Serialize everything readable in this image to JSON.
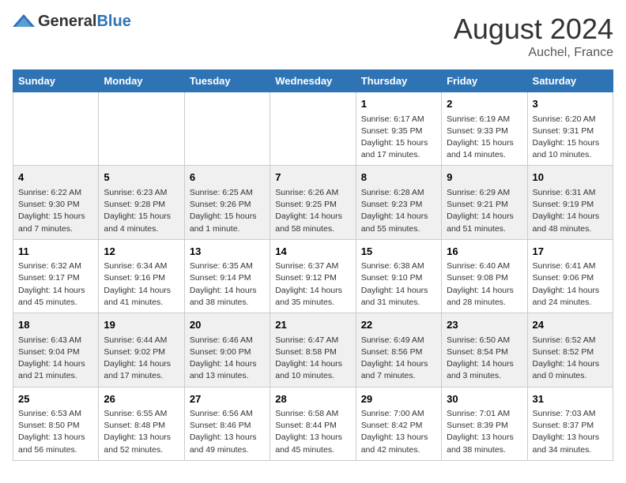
{
  "header": {
    "logo_general": "General",
    "logo_blue": "Blue",
    "month_year": "August 2024",
    "location": "Auchel, France"
  },
  "days_of_week": [
    "Sunday",
    "Monday",
    "Tuesday",
    "Wednesday",
    "Thursday",
    "Friday",
    "Saturday"
  ],
  "weeks": [
    [
      {
        "day": "",
        "info": ""
      },
      {
        "day": "",
        "info": ""
      },
      {
        "day": "",
        "info": ""
      },
      {
        "day": "",
        "info": ""
      },
      {
        "day": "1",
        "info": "Sunrise: 6:17 AM\nSunset: 9:35 PM\nDaylight: 15 hours and 17 minutes."
      },
      {
        "day": "2",
        "info": "Sunrise: 6:19 AM\nSunset: 9:33 PM\nDaylight: 15 hours and 14 minutes."
      },
      {
        "day": "3",
        "info": "Sunrise: 6:20 AM\nSunset: 9:31 PM\nDaylight: 15 hours and 10 minutes."
      }
    ],
    [
      {
        "day": "4",
        "info": "Sunrise: 6:22 AM\nSunset: 9:30 PM\nDaylight: 15 hours and 7 minutes."
      },
      {
        "day": "5",
        "info": "Sunrise: 6:23 AM\nSunset: 9:28 PM\nDaylight: 15 hours and 4 minutes."
      },
      {
        "day": "6",
        "info": "Sunrise: 6:25 AM\nSunset: 9:26 PM\nDaylight: 15 hours and 1 minute."
      },
      {
        "day": "7",
        "info": "Sunrise: 6:26 AM\nSunset: 9:25 PM\nDaylight: 14 hours and 58 minutes."
      },
      {
        "day": "8",
        "info": "Sunrise: 6:28 AM\nSunset: 9:23 PM\nDaylight: 14 hours and 55 minutes."
      },
      {
        "day": "9",
        "info": "Sunrise: 6:29 AM\nSunset: 9:21 PM\nDaylight: 14 hours and 51 minutes."
      },
      {
        "day": "10",
        "info": "Sunrise: 6:31 AM\nSunset: 9:19 PM\nDaylight: 14 hours and 48 minutes."
      }
    ],
    [
      {
        "day": "11",
        "info": "Sunrise: 6:32 AM\nSunset: 9:17 PM\nDaylight: 14 hours and 45 minutes."
      },
      {
        "day": "12",
        "info": "Sunrise: 6:34 AM\nSunset: 9:16 PM\nDaylight: 14 hours and 41 minutes."
      },
      {
        "day": "13",
        "info": "Sunrise: 6:35 AM\nSunset: 9:14 PM\nDaylight: 14 hours and 38 minutes."
      },
      {
        "day": "14",
        "info": "Sunrise: 6:37 AM\nSunset: 9:12 PM\nDaylight: 14 hours and 35 minutes."
      },
      {
        "day": "15",
        "info": "Sunrise: 6:38 AM\nSunset: 9:10 PM\nDaylight: 14 hours and 31 minutes."
      },
      {
        "day": "16",
        "info": "Sunrise: 6:40 AM\nSunset: 9:08 PM\nDaylight: 14 hours and 28 minutes."
      },
      {
        "day": "17",
        "info": "Sunrise: 6:41 AM\nSunset: 9:06 PM\nDaylight: 14 hours and 24 minutes."
      }
    ],
    [
      {
        "day": "18",
        "info": "Sunrise: 6:43 AM\nSunset: 9:04 PM\nDaylight: 14 hours and 21 minutes."
      },
      {
        "day": "19",
        "info": "Sunrise: 6:44 AM\nSunset: 9:02 PM\nDaylight: 14 hours and 17 minutes."
      },
      {
        "day": "20",
        "info": "Sunrise: 6:46 AM\nSunset: 9:00 PM\nDaylight: 14 hours and 13 minutes."
      },
      {
        "day": "21",
        "info": "Sunrise: 6:47 AM\nSunset: 8:58 PM\nDaylight: 14 hours and 10 minutes."
      },
      {
        "day": "22",
        "info": "Sunrise: 6:49 AM\nSunset: 8:56 PM\nDaylight: 14 hours and 7 minutes."
      },
      {
        "day": "23",
        "info": "Sunrise: 6:50 AM\nSunset: 8:54 PM\nDaylight: 14 hours and 3 minutes."
      },
      {
        "day": "24",
        "info": "Sunrise: 6:52 AM\nSunset: 8:52 PM\nDaylight: 14 hours and 0 minutes."
      }
    ],
    [
      {
        "day": "25",
        "info": "Sunrise: 6:53 AM\nSunset: 8:50 PM\nDaylight: 13 hours and 56 minutes."
      },
      {
        "day": "26",
        "info": "Sunrise: 6:55 AM\nSunset: 8:48 PM\nDaylight: 13 hours and 52 minutes."
      },
      {
        "day": "27",
        "info": "Sunrise: 6:56 AM\nSunset: 8:46 PM\nDaylight: 13 hours and 49 minutes."
      },
      {
        "day": "28",
        "info": "Sunrise: 6:58 AM\nSunset: 8:44 PM\nDaylight: 13 hours and 45 minutes."
      },
      {
        "day": "29",
        "info": "Sunrise: 7:00 AM\nSunset: 8:42 PM\nDaylight: 13 hours and 42 minutes."
      },
      {
        "day": "30",
        "info": "Sunrise: 7:01 AM\nSunset: 8:39 PM\nDaylight: 13 hours and 38 minutes."
      },
      {
        "day": "31",
        "info": "Sunrise: 7:03 AM\nSunset: 8:37 PM\nDaylight: 13 hours and 34 minutes."
      }
    ]
  ]
}
